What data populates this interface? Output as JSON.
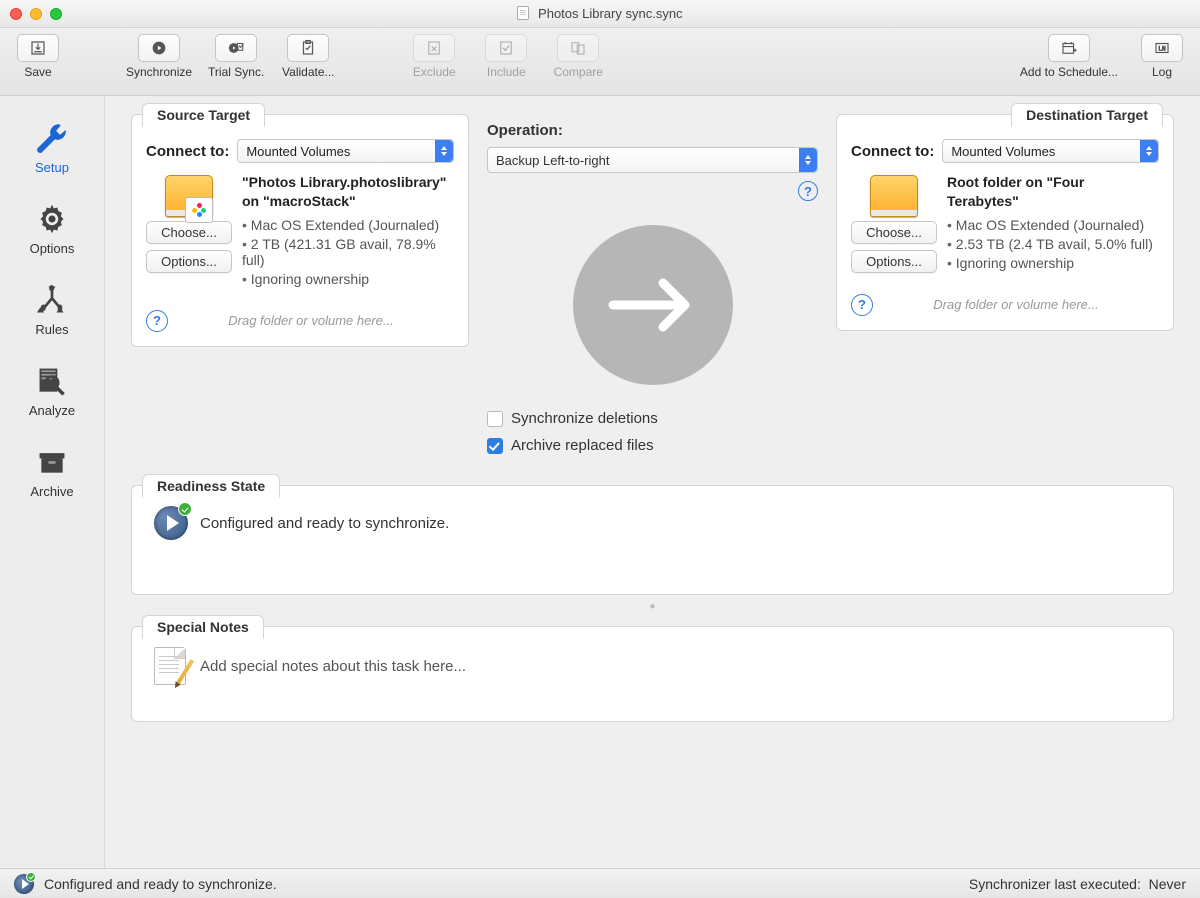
{
  "window": {
    "title": "Photos Library sync.sync"
  },
  "toolbar": {
    "save": "Save",
    "synchronize": "Synchronize",
    "trial": "Trial Sync.",
    "validate": "Validate...",
    "exclude": "Exclude",
    "include": "Include",
    "compare": "Compare",
    "schedule": "Add to Schedule...",
    "log": "Log"
  },
  "sidebar": {
    "setup": "Setup",
    "options": "Options",
    "rules": "Rules",
    "analyze": "Analyze",
    "archive": "Archive"
  },
  "source": {
    "tab": "Source Target",
    "connect_label": "Connect to:",
    "connect_value": "Mounted Volumes",
    "title": "\"Photos Library.photoslibrary\" on \"macroStack\"",
    "b1": "Mac OS Extended (Journaled)",
    "b2": "2 TB (421.31 GB avail, 78.9% full)",
    "b3": "Ignoring ownership",
    "choose": "Choose...",
    "options": "Options...",
    "drag": "Drag folder or volume here..."
  },
  "dest": {
    "tab": "Destination Target",
    "connect_label": "Connect to:",
    "connect_value": "Mounted Volumes",
    "title": "Root folder on \"Four Terabytes\"",
    "b1": "Mac OS Extended (Journaled)",
    "b2": "2.53 TB (2.4 TB avail, 5.0% full)",
    "b3": "Ignoring ownership",
    "choose": "Choose...",
    "options": "Options...",
    "drag": "Drag folder or volume here..."
  },
  "operation": {
    "label": "Operation:",
    "value": "Backup Left-to-right",
    "sync_deletions": "Synchronize deletions",
    "archive_replaced": "Archive replaced files"
  },
  "readiness": {
    "tab": "Readiness State",
    "text": "Configured and ready to synchronize."
  },
  "notes": {
    "tab": "Special Notes",
    "placeholder": "Add special notes about this task here..."
  },
  "statusbar": {
    "text": "Configured and ready to synchronize.",
    "right_label": "Synchronizer last executed:",
    "right_value": "Never"
  }
}
